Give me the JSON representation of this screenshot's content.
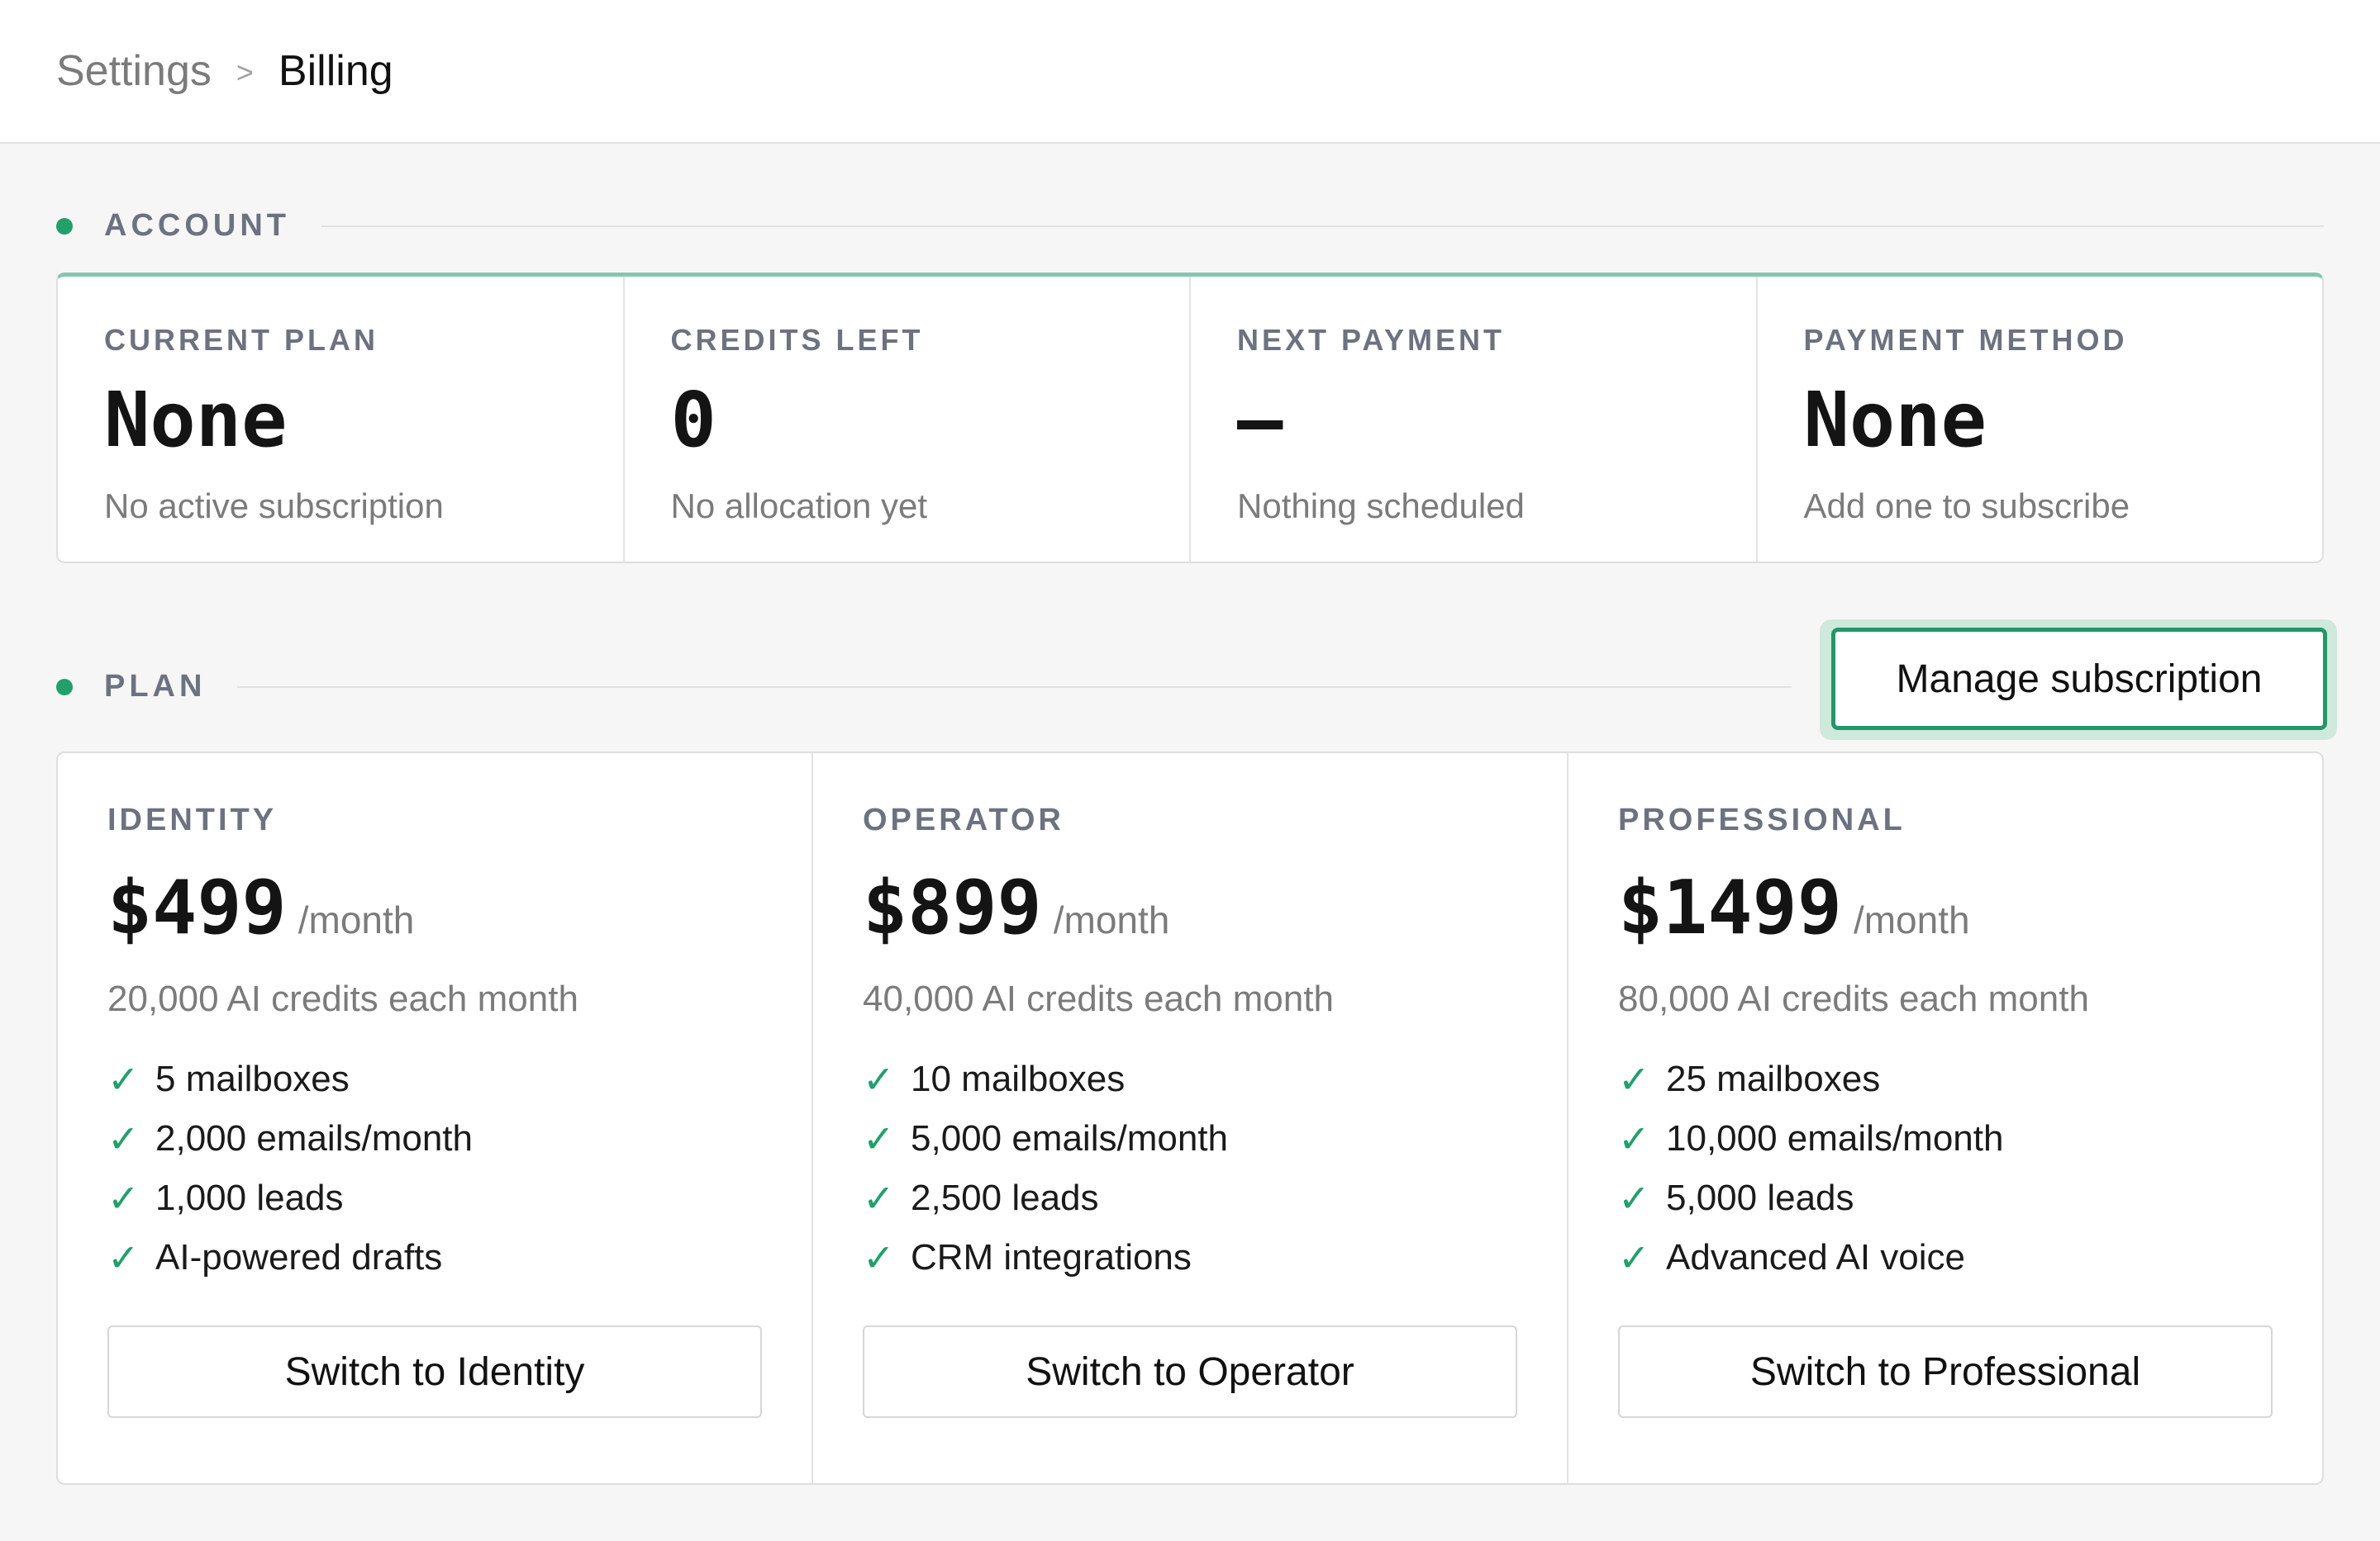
{
  "breadcrumb": {
    "parent": "Settings",
    "separator": ">",
    "current": "Billing"
  },
  "account": {
    "section_label": "ACCOUNT",
    "stats": [
      {
        "label": "CURRENT PLAN",
        "value": "None",
        "sub": "No active subscription"
      },
      {
        "label": "CREDITS LEFT",
        "value": "0",
        "sub": "No allocation yet"
      },
      {
        "label": "NEXT PAYMENT",
        "value": "—",
        "sub": "Nothing scheduled"
      },
      {
        "label": "PAYMENT METHOD",
        "value": "None",
        "sub": "Add one to subscribe"
      }
    ]
  },
  "plan": {
    "section_label": "PLAN",
    "manage_label": "Manage subscription",
    "plans": [
      {
        "name": "IDENTITY",
        "price": "$499",
        "period": "/month",
        "credits": "20,000 AI credits each month",
        "features": [
          "5 mailboxes",
          "2,000 emails/month",
          "1,000 leads",
          "AI-powered drafts"
        ],
        "button": "Switch to Identity"
      },
      {
        "name": "OPERATOR",
        "price": "$899",
        "period": "/month",
        "credits": "40,000 AI credits each month",
        "features": [
          "10 mailboxes",
          "5,000 emails/month",
          "2,500 leads",
          "CRM integrations"
        ],
        "button": "Switch to Operator"
      },
      {
        "name": "PROFESSIONAL",
        "price": "$1499",
        "period": "/month",
        "credits": "80,000 AI credits each month",
        "features": [
          "25 mailboxes",
          "10,000 emails/month",
          "5,000 leads",
          "Advanced AI voice"
        ],
        "button": "Switch to Professional"
      }
    ]
  },
  "icons": {
    "check": "✓"
  },
  "colors": {
    "accent": "#22a06b",
    "accent_border": "#23966a",
    "card_top": "#84c7ab"
  }
}
